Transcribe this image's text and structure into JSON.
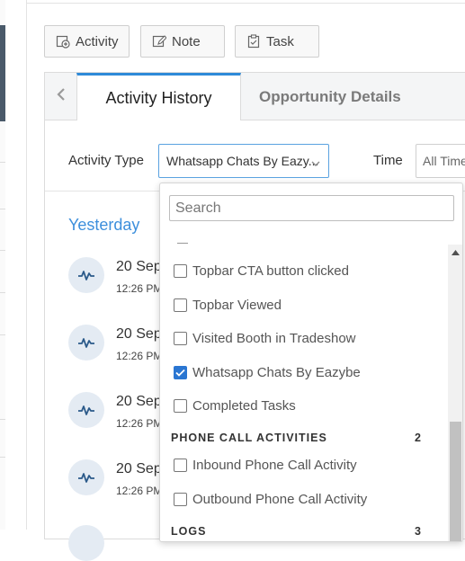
{
  "toolbar": {
    "activity_label": "Activity",
    "note_label": "Note",
    "task_label": "Task",
    "activity_icon": "add-activity-icon",
    "note_icon": "edit-note-icon",
    "task_icon": "task-clipboard-icon"
  },
  "tabs": {
    "active": "Activity History",
    "inactive": "Opportunity Details",
    "prev_icon": "chevron-left-icon"
  },
  "filters": {
    "activity_type_label": "Activity Type",
    "activity_type_value": "Whatsapp Chats By Eazy...",
    "time_label": "Time",
    "time_value": "All Time"
  },
  "timeline": {
    "day_heading": "Yesterday",
    "items": [
      {
        "date": "20 Sep",
        "time": "12:26 PM"
      },
      {
        "date": "20 Sep",
        "time": "12:26 PM"
      },
      {
        "date": "20 Sep",
        "time": "12:26 PM"
      },
      {
        "date": "20 Sep",
        "time": "12:26 PM"
      }
    ]
  },
  "dropdown": {
    "search_placeholder": "Search",
    "options_top": [
      {
        "label": "Topbar CTA button clicked",
        "checked": false
      },
      {
        "label": "Topbar Viewed",
        "checked": false
      },
      {
        "label": "Visited Booth in Tradeshow",
        "checked": false
      },
      {
        "label": "Whatsapp Chats By Eazybe",
        "checked": true
      },
      {
        "label": "Completed Tasks",
        "checked": false
      }
    ],
    "group_phone": {
      "label": "PHONE CALL ACTIVITIES",
      "count": "2"
    },
    "options_phone": [
      {
        "label": "Inbound Phone Call Activity",
        "checked": false
      },
      {
        "label": "Outbound Phone Call Activity",
        "checked": false
      }
    ],
    "group_logs": {
      "label": "LOGS",
      "count": "3"
    }
  },
  "colors": {
    "accent": "#2e8ad8",
    "heading_blue": "#3d8fdc",
    "checkbox_checked": "#2a76d2"
  }
}
